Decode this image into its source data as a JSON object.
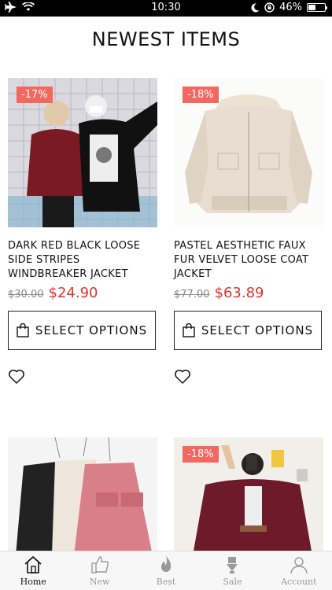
{
  "status_bar": {
    "time": "10:30",
    "battery": "46%",
    "battery_level": 0.46
  },
  "page_title": "NEWEST ITEMS",
  "products": [
    {
      "badge": "-17%",
      "name": "DARK RED BLACK LOOSE SIDE STRIPES WINDBREAKER JACKET",
      "old_price": "$30.00",
      "new_price": "$24.90",
      "button": "SELECT OPTIONS"
    },
    {
      "badge": "-18%",
      "name": "PASTEL AESTHETIC FAUX FUR VELVET LOOSE COAT JACKET",
      "old_price": "$77.00",
      "new_price": "$63.89",
      "button": "SELECT OPTIONS"
    },
    {
      "badge": "",
      "name": "",
      "old_price": "",
      "new_price": "",
      "button": ""
    },
    {
      "badge": "-18%",
      "name": "",
      "old_price": "",
      "new_price": "",
      "button": ""
    }
  ],
  "bottom_nav": [
    {
      "label": "Home",
      "icon": "home-icon",
      "active": true
    },
    {
      "label": "New",
      "icon": "thumbs-up-icon",
      "active": false
    },
    {
      "label": "Best",
      "icon": "flame-icon",
      "active": false
    },
    {
      "label": "Sale",
      "icon": "sale-tag-icon",
      "active": false
    },
    {
      "label": "Account",
      "icon": "user-icon",
      "active": false
    }
  ],
  "colors": {
    "badge": "#f2675f",
    "sale_price": "#e0332e",
    "old_price": "#888888"
  }
}
